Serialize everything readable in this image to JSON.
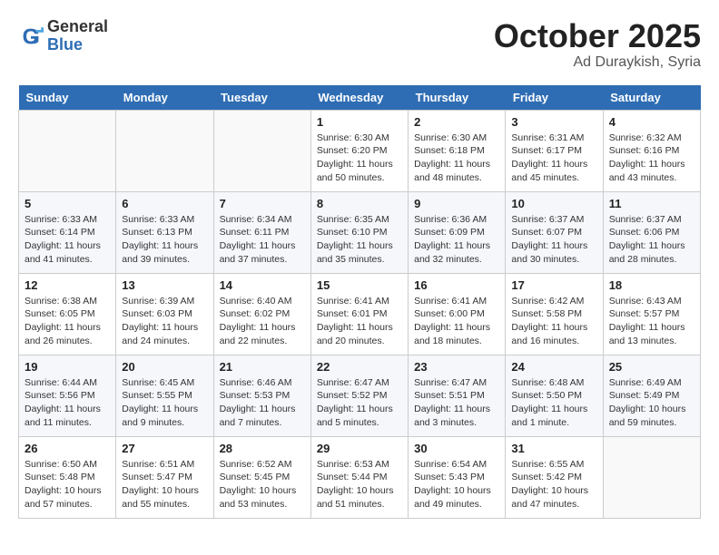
{
  "header": {
    "logo_general": "General",
    "logo_blue": "Blue",
    "month_title": "October 2025",
    "location": "Ad Duraykish, Syria"
  },
  "days_of_week": [
    "Sunday",
    "Monday",
    "Tuesday",
    "Wednesday",
    "Thursday",
    "Friday",
    "Saturday"
  ],
  "weeks": [
    [
      {
        "day": "",
        "sunrise": "",
        "sunset": "",
        "daylight": "",
        "empty": true
      },
      {
        "day": "",
        "sunrise": "",
        "sunset": "",
        "daylight": "",
        "empty": true
      },
      {
        "day": "",
        "sunrise": "",
        "sunset": "",
        "daylight": "",
        "empty": true
      },
      {
        "day": "1",
        "sunrise": "Sunrise: 6:30 AM",
        "sunset": "Sunset: 6:20 PM",
        "daylight": "Daylight: 11 hours and 50 minutes.",
        "empty": false
      },
      {
        "day": "2",
        "sunrise": "Sunrise: 6:30 AM",
        "sunset": "Sunset: 6:18 PM",
        "daylight": "Daylight: 11 hours and 48 minutes.",
        "empty": false
      },
      {
        "day": "3",
        "sunrise": "Sunrise: 6:31 AM",
        "sunset": "Sunset: 6:17 PM",
        "daylight": "Daylight: 11 hours and 45 minutes.",
        "empty": false
      },
      {
        "day": "4",
        "sunrise": "Sunrise: 6:32 AM",
        "sunset": "Sunset: 6:16 PM",
        "daylight": "Daylight: 11 hours and 43 minutes.",
        "empty": false
      }
    ],
    [
      {
        "day": "5",
        "sunrise": "Sunrise: 6:33 AM",
        "sunset": "Sunset: 6:14 PM",
        "daylight": "Daylight: 11 hours and 41 minutes.",
        "empty": false
      },
      {
        "day": "6",
        "sunrise": "Sunrise: 6:33 AM",
        "sunset": "Sunset: 6:13 PM",
        "daylight": "Daylight: 11 hours and 39 minutes.",
        "empty": false
      },
      {
        "day": "7",
        "sunrise": "Sunrise: 6:34 AM",
        "sunset": "Sunset: 6:11 PM",
        "daylight": "Daylight: 11 hours and 37 minutes.",
        "empty": false
      },
      {
        "day": "8",
        "sunrise": "Sunrise: 6:35 AM",
        "sunset": "Sunset: 6:10 PM",
        "daylight": "Daylight: 11 hours and 35 minutes.",
        "empty": false
      },
      {
        "day": "9",
        "sunrise": "Sunrise: 6:36 AM",
        "sunset": "Sunset: 6:09 PM",
        "daylight": "Daylight: 11 hours and 32 minutes.",
        "empty": false
      },
      {
        "day": "10",
        "sunrise": "Sunrise: 6:37 AM",
        "sunset": "Sunset: 6:07 PM",
        "daylight": "Daylight: 11 hours and 30 minutes.",
        "empty": false
      },
      {
        "day": "11",
        "sunrise": "Sunrise: 6:37 AM",
        "sunset": "Sunset: 6:06 PM",
        "daylight": "Daylight: 11 hours and 28 minutes.",
        "empty": false
      }
    ],
    [
      {
        "day": "12",
        "sunrise": "Sunrise: 6:38 AM",
        "sunset": "Sunset: 6:05 PM",
        "daylight": "Daylight: 11 hours and 26 minutes.",
        "empty": false
      },
      {
        "day": "13",
        "sunrise": "Sunrise: 6:39 AM",
        "sunset": "Sunset: 6:03 PM",
        "daylight": "Daylight: 11 hours and 24 minutes.",
        "empty": false
      },
      {
        "day": "14",
        "sunrise": "Sunrise: 6:40 AM",
        "sunset": "Sunset: 6:02 PM",
        "daylight": "Daylight: 11 hours and 22 minutes.",
        "empty": false
      },
      {
        "day": "15",
        "sunrise": "Sunrise: 6:41 AM",
        "sunset": "Sunset: 6:01 PM",
        "daylight": "Daylight: 11 hours and 20 minutes.",
        "empty": false
      },
      {
        "day": "16",
        "sunrise": "Sunrise: 6:41 AM",
        "sunset": "Sunset: 6:00 PM",
        "daylight": "Daylight: 11 hours and 18 minutes.",
        "empty": false
      },
      {
        "day": "17",
        "sunrise": "Sunrise: 6:42 AM",
        "sunset": "Sunset: 5:58 PM",
        "daylight": "Daylight: 11 hours and 16 minutes.",
        "empty": false
      },
      {
        "day": "18",
        "sunrise": "Sunrise: 6:43 AM",
        "sunset": "Sunset: 5:57 PM",
        "daylight": "Daylight: 11 hours and 13 minutes.",
        "empty": false
      }
    ],
    [
      {
        "day": "19",
        "sunrise": "Sunrise: 6:44 AM",
        "sunset": "Sunset: 5:56 PM",
        "daylight": "Daylight: 11 hours and 11 minutes.",
        "empty": false
      },
      {
        "day": "20",
        "sunrise": "Sunrise: 6:45 AM",
        "sunset": "Sunset: 5:55 PM",
        "daylight": "Daylight: 11 hours and 9 minutes.",
        "empty": false
      },
      {
        "day": "21",
        "sunrise": "Sunrise: 6:46 AM",
        "sunset": "Sunset: 5:53 PM",
        "daylight": "Daylight: 11 hours and 7 minutes.",
        "empty": false
      },
      {
        "day": "22",
        "sunrise": "Sunrise: 6:47 AM",
        "sunset": "Sunset: 5:52 PM",
        "daylight": "Daylight: 11 hours and 5 minutes.",
        "empty": false
      },
      {
        "day": "23",
        "sunrise": "Sunrise: 6:47 AM",
        "sunset": "Sunset: 5:51 PM",
        "daylight": "Daylight: 11 hours and 3 minutes.",
        "empty": false
      },
      {
        "day": "24",
        "sunrise": "Sunrise: 6:48 AM",
        "sunset": "Sunset: 5:50 PM",
        "daylight": "Daylight: 11 hours and 1 minute.",
        "empty": false
      },
      {
        "day": "25",
        "sunrise": "Sunrise: 6:49 AM",
        "sunset": "Sunset: 5:49 PM",
        "daylight": "Daylight: 10 hours and 59 minutes.",
        "empty": false
      }
    ],
    [
      {
        "day": "26",
        "sunrise": "Sunrise: 6:50 AM",
        "sunset": "Sunset: 5:48 PM",
        "daylight": "Daylight: 10 hours and 57 minutes.",
        "empty": false
      },
      {
        "day": "27",
        "sunrise": "Sunrise: 6:51 AM",
        "sunset": "Sunset: 5:47 PM",
        "daylight": "Daylight: 10 hours and 55 minutes.",
        "empty": false
      },
      {
        "day": "28",
        "sunrise": "Sunrise: 6:52 AM",
        "sunset": "Sunset: 5:45 PM",
        "daylight": "Daylight: 10 hours and 53 minutes.",
        "empty": false
      },
      {
        "day": "29",
        "sunrise": "Sunrise: 6:53 AM",
        "sunset": "Sunset: 5:44 PM",
        "daylight": "Daylight: 10 hours and 51 minutes.",
        "empty": false
      },
      {
        "day": "30",
        "sunrise": "Sunrise: 6:54 AM",
        "sunset": "Sunset: 5:43 PM",
        "daylight": "Daylight: 10 hours and 49 minutes.",
        "empty": false
      },
      {
        "day": "31",
        "sunrise": "Sunrise: 6:55 AM",
        "sunset": "Sunset: 5:42 PM",
        "daylight": "Daylight: 10 hours and 47 minutes.",
        "empty": false
      },
      {
        "day": "",
        "sunrise": "",
        "sunset": "",
        "daylight": "",
        "empty": true
      }
    ]
  ]
}
